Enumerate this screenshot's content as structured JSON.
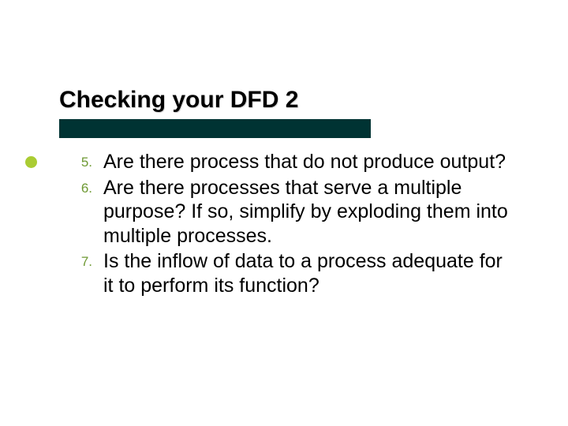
{
  "title": "Checking your DFD 2",
  "items": [
    {
      "num": "5.",
      "text": "Are there process that do not produce output?"
    },
    {
      "num": "6.",
      "text": "Are there processes that serve a multiple purpose? If so, simplify by exploding them into multiple processes."
    },
    {
      "num": "7.",
      "text": "Is the inflow of data to a process adequate for it to perform its function?"
    }
  ]
}
